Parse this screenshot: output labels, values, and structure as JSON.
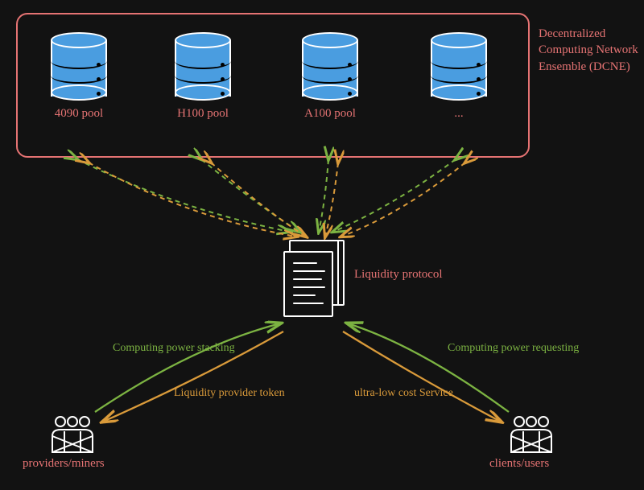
{
  "dcne": {
    "title": "Decentralized Computing Network Ensemble (DCNE)",
    "pools": [
      "4090 pool",
      "H100 pool",
      "A100 pool",
      "..."
    ]
  },
  "liquidity": {
    "label": "Liquidity protocol"
  },
  "actors": {
    "providers": "providers/miners",
    "clients": "clients/users"
  },
  "flows": {
    "power_stacking": "Computing power stacking",
    "provider_token": "Liquidity provider token",
    "power_requesting": "Computing power requesting",
    "low_cost": "ultra-low cost Service"
  },
  "colors": {
    "accent_red": "#e57373",
    "green": "#7cb342",
    "orange": "#d99a3a",
    "cylinder": "#4a9de0",
    "background": "#121212"
  }
}
